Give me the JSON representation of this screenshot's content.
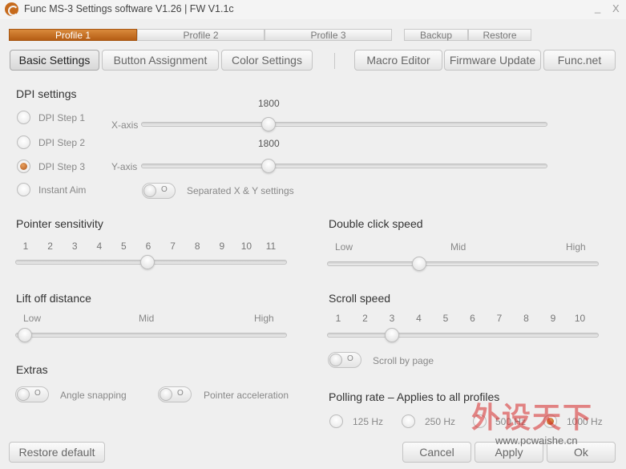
{
  "window": {
    "title": "Func MS-3 Settings software V1.26 | FW V1.1c",
    "min_symbol": "_",
    "close_symbol": "X",
    "accent": "#c66a1c"
  },
  "profiles": [
    {
      "label": "Profile 1",
      "active": true
    },
    {
      "label": "Profile 2",
      "active": false
    },
    {
      "label": "Profile 3",
      "active": false
    }
  ],
  "profile_actions": {
    "backup": "Backup",
    "restore": "Restore"
  },
  "nav": {
    "basic": "Basic Settings",
    "button": "Button Assignment",
    "color": "Color Settings",
    "macro": "Macro Editor",
    "firmware": "Firmware Update",
    "funcnet": "Func.net"
  },
  "dpi": {
    "heading": "DPI settings",
    "steps": [
      "DPI Step 1",
      "DPI Step 2",
      "DPI Step 3",
      "Instant Aim"
    ],
    "selected_step": "DPI Step 3",
    "x_label": "X-axis",
    "y_label": "Y-axis",
    "x_value": "1800",
    "y_value": "1800",
    "slider_fraction": 0.31,
    "separated_label": "Separated X & Y settings",
    "separated_on": false
  },
  "pointer": {
    "heading": "Pointer sensitivity",
    "ticks": [
      "1",
      "2",
      "3",
      "4",
      "5",
      "6",
      "7",
      "8",
      "9",
      "10",
      "11"
    ],
    "value": 6
  },
  "double_click": {
    "heading": "Double click speed",
    "low": "Low",
    "mid": "Mid",
    "high": "High",
    "fraction": 0.34
  },
  "lift_off": {
    "heading": "Lift off distance",
    "low": "Low",
    "mid": "Mid",
    "high": "High",
    "fraction": 0.0
  },
  "scroll": {
    "heading": "Scroll speed",
    "ticks": [
      "1",
      "2",
      "3",
      "4",
      "5",
      "6",
      "7",
      "8",
      "9",
      "10"
    ],
    "value": 3,
    "scroll_by_page_label": "Scroll by page",
    "scroll_by_page_on": false
  },
  "extras": {
    "heading": "Extras",
    "angle_snapping": "Angle snapping",
    "pointer_accel": "Pointer acceleration",
    "toggle_mark": "O"
  },
  "polling": {
    "heading": "Polling rate – Applies to all profiles",
    "options": [
      "125 Hz",
      "250 Hz",
      "500 Hz",
      "1000 Hz"
    ],
    "selected": "1000 Hz"
  },
  "footer": {
    "restore_default": "Restore default",
    "cancel": "Cancel",
    "apply": "Apply",
    "ok": "Ok"
  },
  "watermark": {
    "text": "外设天下",
    "url": "www.pcwaishe.cn"
  }
}
